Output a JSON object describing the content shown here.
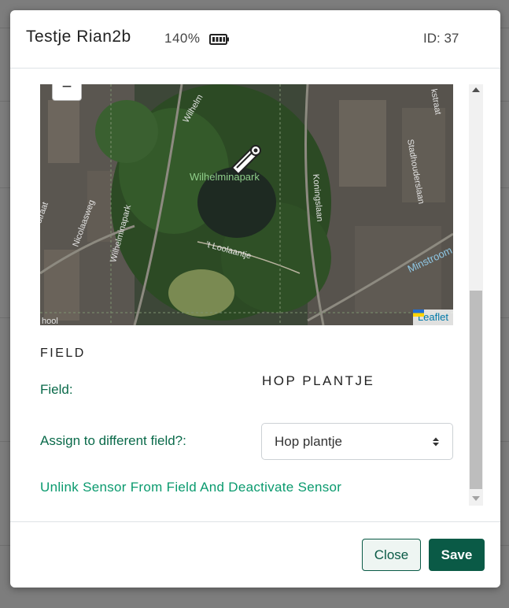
{
  "modal": {
    "title": "Testje Rian2b",
    "battery": "140%",
    "battery_icon": "battery-full-icon",
    "sensor_id": "ID: 37"
  },
  "map": {
    "zoom_out": "−",
    "attribution": "Leaflet",
    "marker_icon": "sensor-marker-icon",
    "labels": {
      "park": "Wilhelminapark",
      "park_road": "Wilhelminapark",
      "nicolaasweg": "Nicolaasweg",
      "koningslaan": "Koningslaan",
      "stadhouderslaan": "Stadhouderslaan",
      "loolaantje": "'t Loolaantje",
      "minstroom": "Minstroom",
      "wilhelm": "Wilhelm",
      "straat_left": "straat",
      "kstraat": "kstraat",
      "hool": "hool"
    }
  },
  "field_section": {
    "title": "FIELD",
    "field_label": "Field:",
    "field_value": "HOP PLANTJE",
    "assign_label": "Assign to different field?:",
    "assign_selected": "Hop plantje",
    "unlink_link": "Unlink Sensor From Field And Deactivate Sensor"
  },
  "footer": {
    "close_label": "Close",
    "save_label": "Save"
  },
  "colors": {
    "primary": "#0a5a46",
    "link": "#0a9a6e",
    "overlay": "#7d7d7d"
  }
}
